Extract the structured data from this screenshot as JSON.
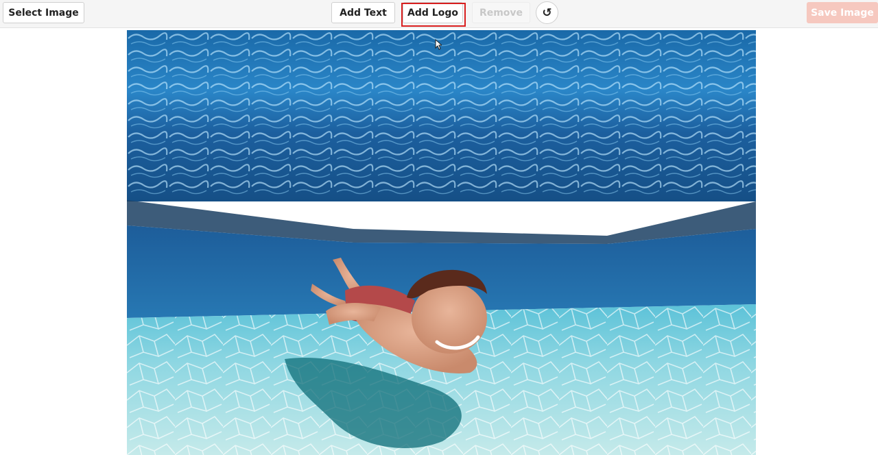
{
  "toolbar": {
    "select_image_label": "Select Image",
    "add_text_label": "Add Text",
    "add_logo_label": "Add Logo",
    "remove_label": "Remove",
    "reset_icon": "↺",
    "save_image_label": "Save Image"
  },
  "colors": {
    "highlight": "#d81e1e",
    "save_button_disabled": "#f6c8bf",
    "water_surface": "#1f73b8",
    "pool_floor": "#a8e3ea"
  },
  "icons": {
    "reset": "rotate-ccw-icon",
    "pointer": "mouse-cursor-icon"
  },
  "canvas": {
    "image_subject": "underwater-swimmer-photo"
  }
}
